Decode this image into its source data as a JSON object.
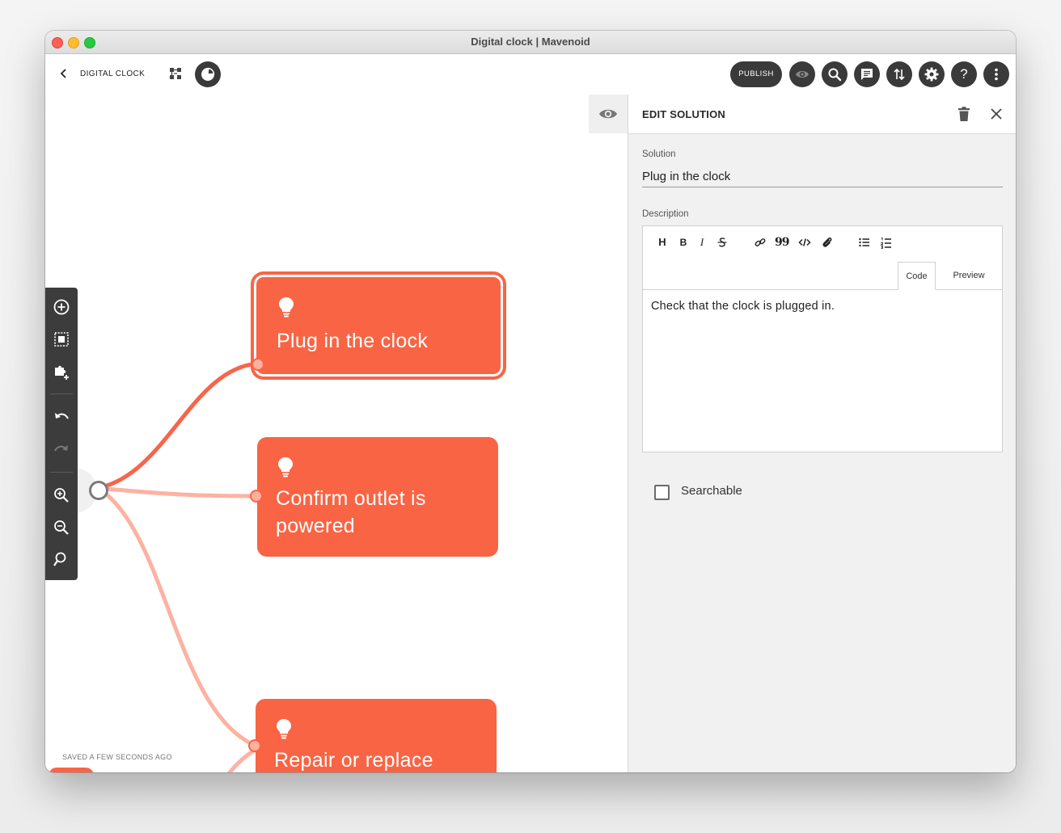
{
  "window": {
    "title": "Digital clock | Mavenoid"
  },
  "header": {
    "project_title": "DIGITAL CLOCK",
    "publish_label": "PUBLISH",
    "help_glyph": "?"
  },
  "canvas": {
    "nodes": [
      {
        "label": "Plug in the clock",
        "selected": true
      },
      {
        "label_line1": "Confirm outlet is",
        "label_line2": "powered",
        "selected": false
      },
      {
        "label": "Repair or replace",
        "selected": false
      }
    ],
    "saved_status": "SAVED A FEW SECONDS AGO"
  },
  "panel": {
    "title": "EDIT SOLUTION",
    "solution_label": "Solution",
    "solution_value": "Plug in the clock",
    "description_label": "Description",
    "editor_tabs": {
      "code": "Code",
      "preview": "Preview"
    },
    "editor_toolbar": {
      "heading": "H",
      "bold": "B",
      "italic": "I",
      "quote": "99"
    },
    "description_text": "Check that the clock is plugged in.",
    "searchable_label": "Searchable",
    "searchable_checked": false
  },
  "colors": {
    "node": "#f96444",
    "link_active": "#f7654a",
    "link_inactive": "#fcb2a2",
    "dark_button": "#3a3a3a",
    "panel_bg": "#f1f1f1"
  },
  "icons": {
    "header": [
      "chevron-left-icon",
      "tree-icon",
      "pie-chart-icon",
      "eye-icon",
      "search-icon",
      "comment-icon",
      "sort-arrows-icon",
      "gear-icon",
      "help-icon",
      "more-vertical-icon"
    ],
    "tools": [
      "add-circle-icon",
      "select-all-icon",
      "puzzle-add-icon",
      "undo-icon",
      "redo-icon",
      "zoom-in-icon",
      "zoom-out-icon",
      "zoom-reset-icon"
    ]
  }
}
